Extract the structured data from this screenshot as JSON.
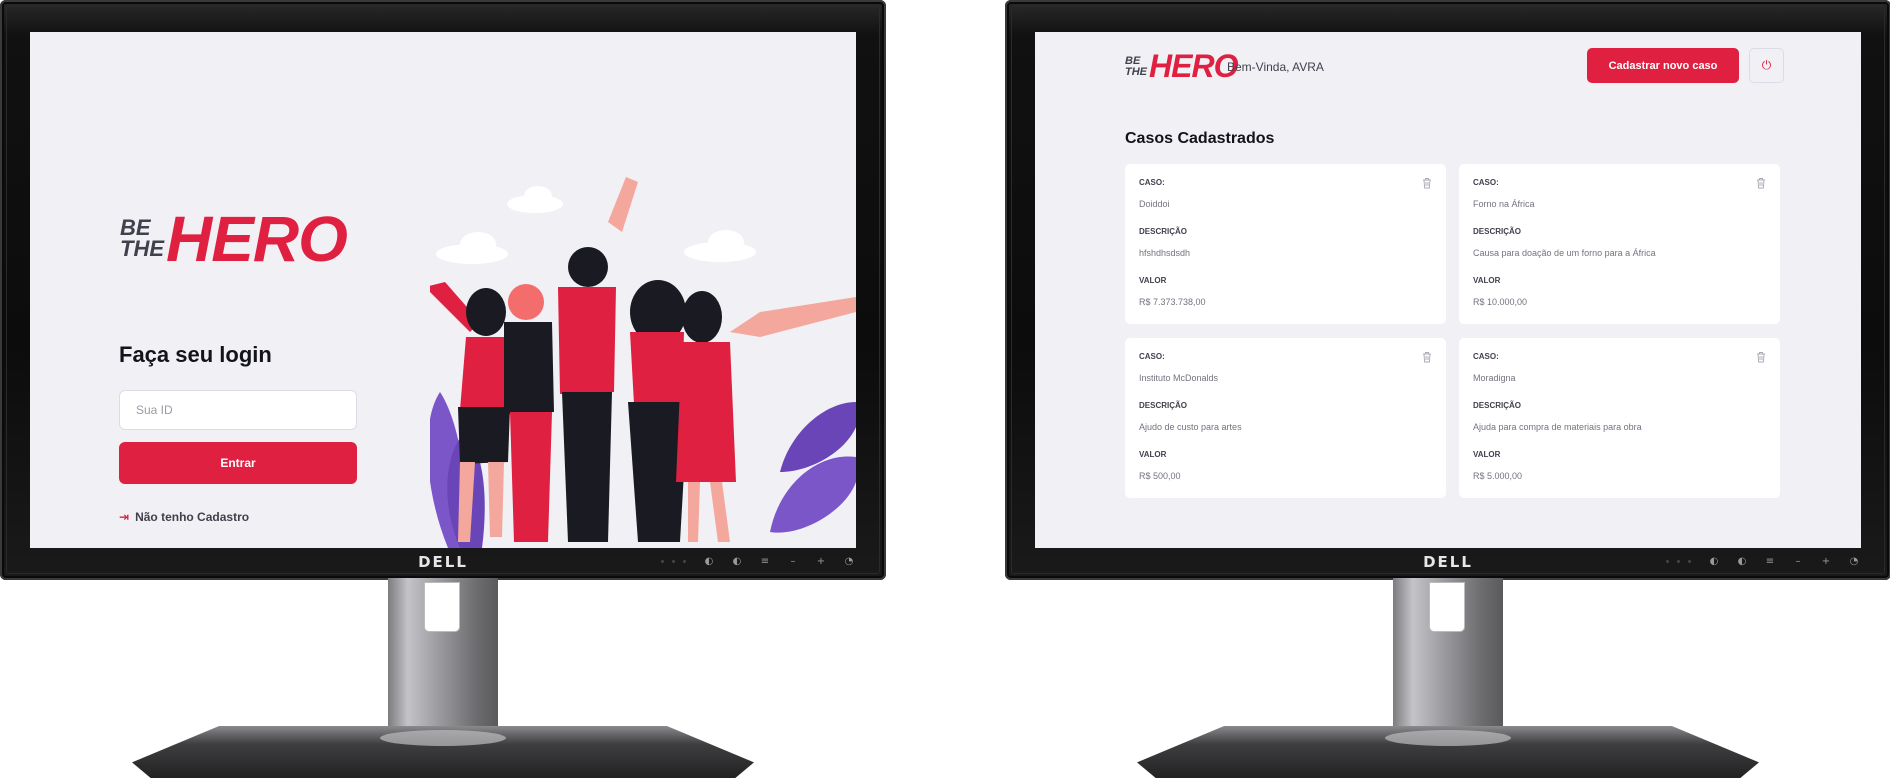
{
  "monitor_brand": "DELL",
  "brand_logo": {
    "small_line_1": "BE",
    "small_line_2": "THE",
    "big": "HERO"
  },
  "login": {
    "title": "Faça seu login",
    "id_placeholder": "Sua ID",
    "submit_label": "Entrar",
    "register_link": "Não tenho Cadastro"
  },
  "dashboard": {
    "welcome": "Bem-Vinda, AVRA",
    "new_case_label": "Cadastrar novo caso",
    "section_title": "Casos Cadastrados",
    "field_labels": {
      "case": "CASO:",
      "description": "DESCRIÇÃO",
      "value": "VALOR"
    },
    "cases": [
      {
        "case": "Doiddoi",
        "description": "hfshdhsdsdh",
        "value": "R$ 7.373.738,00"
      },
      {
        "case": "Forno na África",
        "description": "Causa para doação de um forno para a África",
        "value": "R$ 10.000,00"
      },
      {
        "case": "Instituto McDonalds",
        "description": "Ajudo de custo para artes",
        "value": "R$ 500,00"
      },
      {
        "case": "Moradigna",
        "description": "Ajuda para compra de materiais para obra",
        "value": "R$ 5.000,00"
      }
    ]
  },
  "colors": {
    "accent": "#e02041",
    "background": "#f0f0f5",
    "text": "#41414d",
    "title": "#13131a"
  },
  "icons": {
    "login_link": "log-in-icon",
    "logout": "power-icon",
    "delete": "trash-icon"
  }
}
